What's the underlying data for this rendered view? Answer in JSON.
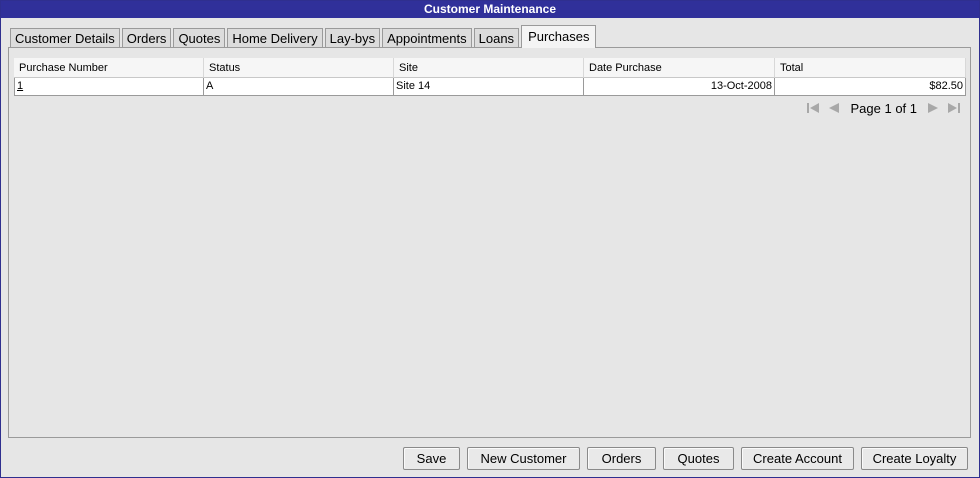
{
  "window": {
    "title": "Customer Maintenance"
  },
  "tabs": [
    {
      "label": "Customer Details"
    },
    {
      "label": "Orders"
    },
    {
      "label": "Quotes"
    },
    {
      "label": "Home Delivery"
    },
    {
      "label": "Lay-bys"
    },
    {
      "label": "Appointments"
    },
    {
      "label": "Loans"
    },
    {
      "label": "Purchases",
      "active": true
    }
  ],
  "grid": {
    "columns": [
      "Purchase Number",
      "Status",
      "Site",
      "Date Purchase",
      "Total"
    ],
    "rows": [
      {
        "purchase_number": "1",
        "status": "A",
        "site": "Site 14",
        "date_purchase": "13-Oct-2008",
        "total": "$82.50"
      }
    ]
  },
  "pager": {
    "text": "Page 1 of 1",
    "icons": [
      "first-page-icon",
      "prev-page-icon",
      "next-page-icon",
      "last-page-icon"
    ],
    "icon_color": "#a8a8a8"
  },
  "buttons": {
    "save": "Save",
    "new_customer": "New Customer",
    "orders": "Orders",
    "quotes": "Quotes",
    "create_account": "Create Account",
    "create_loyalty": "Create Loyalty"
  },
  "colors": {
    "titlebar": "#30309a",
    "background": "#e6e6e6"
  }
}
